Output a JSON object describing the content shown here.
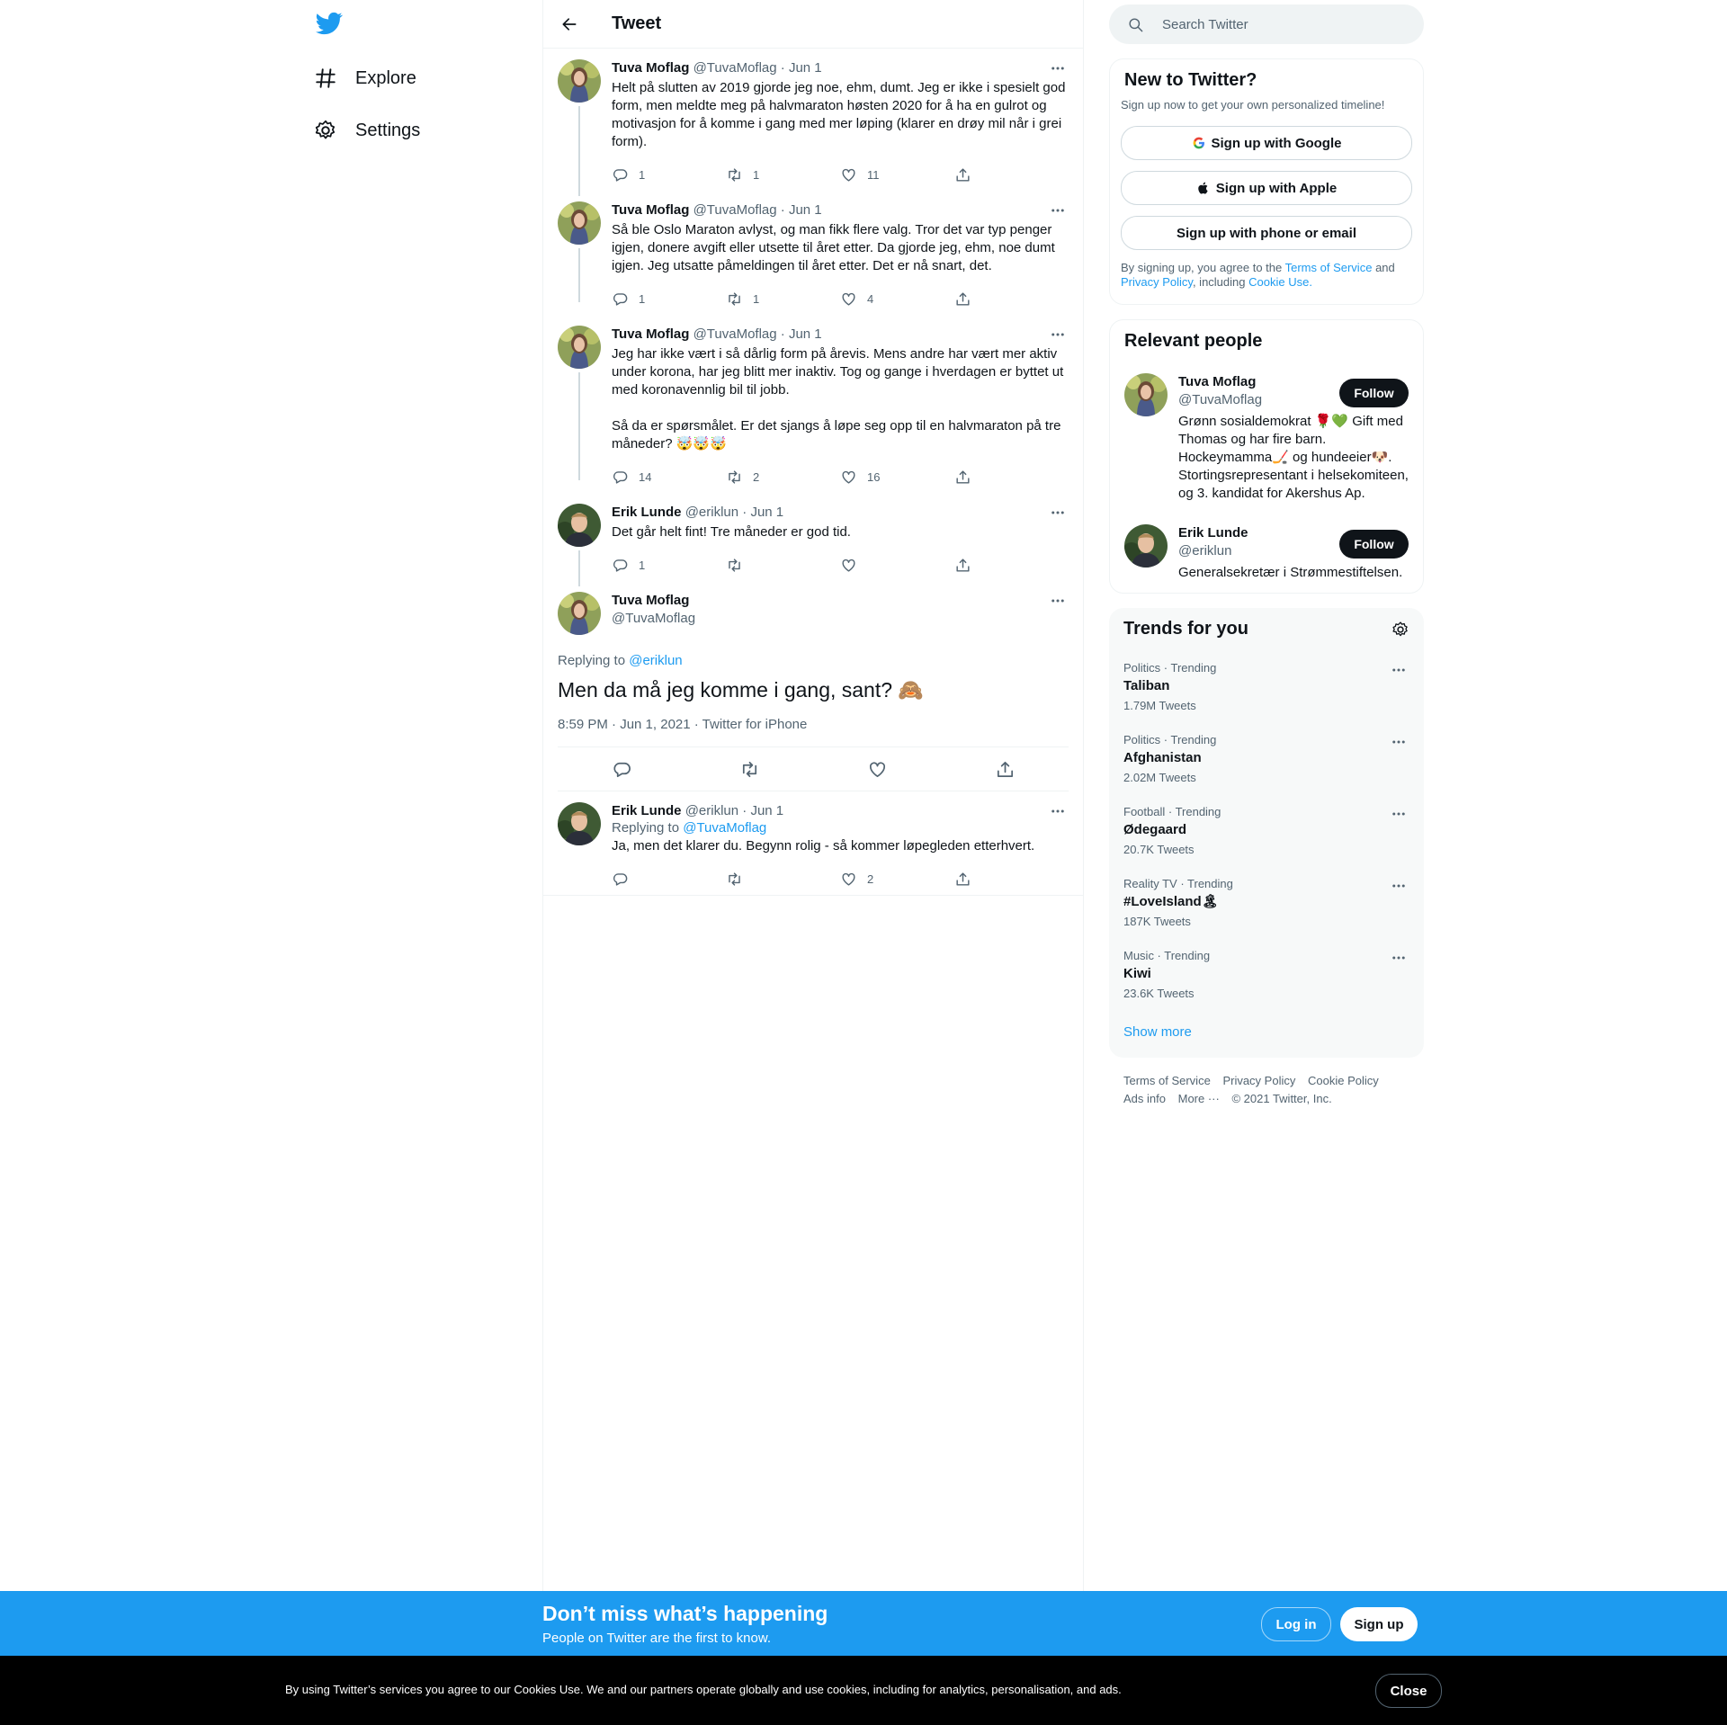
{
  "colors": {
    "accent": "#1d9bf0",
    "text": "#0f1419",
    "secondary": "#536471"
  },
  "nav": {
    "items": [
      {
        "label": "Explore",
        "icon": "hashtag-icon"
      },
      {
        "label": "Settings",
        "icon": "gear-icon"
      }
    ]
  },
  "header": {
    "title": "Tweet"
  },
  "thread": [
    {
      "name": "Tuva Moflag",
      "handle": "@TuvaMoflag",
      "date": "· Jun 1",
      "text": "Helt på slutten av 2019 gjorde jeg noe, ehm, dumt. Jeg er ikke i spesielt god form, men meldte meg på halvmaraton høsten 2020 for å ha en gulrot og motivasjon for å komme i gang med mer løping (klarer en drøy mil når i grei form).",
      "replies": "1",
      "retweets": "1",
      "likes": "11"
    },
    {
      "name": "Tuva Moflag",
      "handle": "@TuvaMoflag",
      "date": "· Jun 1",
      "text": "Så ble Oslo Maraton avlyst, og man fikk flere valg. Tror det var typ penger igjen, donere avgift eller utsette til året etter. Da gjorde jeg, ehm, noe dumt igjen. Jeg utsatte påmeldingen til året etter. Det er nå snart, det.",
      "replies": "1",
      "retweets": "1",
      "likes": "4"
    },
    {
      "name": "Tuva Moflag",
      "handle": "@TuvaMoflag",
      "date": "· Jun 1",
      "text": "Jeg har ikke vært i så dårlig form på årevis. Mens andre har vært mer aktiv under korona, har jeg blitt mer inaktiv. Tog og gange i hverdagen er byttet ut med koronavennlig bil til jobb.\n\nSå da er spørsmålet. Er det sjangs å løpe seg opp til en halvmaraton på tre måneder? 🤯🤯🤯",
      "replies": "14",
      "retweets": "2",
      "likes": "16"
    },
    {
      "name": "Erik Lunde",
      "handle": "@eriklun",
      "date": "· Jun 1",
      "text": "Det går helt fint! Tre måneder er god tid.",
      "replies": "1",
      "retweets": "",
      "likes": ""
    }
  ],
  "focus": {
    "name": "Tuva Moflag",
    "handle": "@TuvaMoflag",
    "replying_label": "Replying to",
    "replying_to": "@eriklun",
    "text": "Men da må jeg komme i gang, sant? 🙈",
    "meta": "8:59 PM · Jun 1, 2021 · Twitter for iPhone"
  },
  "reply": {
    "name": "Erik Lunde",
    "handle": "@eriklun",
    "date": "· Jun 1",
    "replying_label": "Replying to",
    "replying_to": "@TuvaMoflag",
    "text": "Ja, men det klarer du. Begynn rolig - så kommer løpegleden etterhvert.",
    "replies": "",
    "retweets": "",
    "likes": "2"
  },
  "search": {
    "placeholder": "Search Twitter"
  },
  "signup": {
    "title": "New to Twitter?",
    "subtitle": "Sign up now to get your own personalized timeline!",
    "google": "Sign up with Google",
    "apple": "Sign up with Apple",
    "phone": "Sign up with phone or email",
    "legal_1": "By signing up, you agree to the",
    "terms": "Terms of Service",
    "and": "and",
    "privacy": "Privacy Policy",
    "including": ", including",
    "cookie": "Cookie Use."
  },
  "relevant": {
    "title": "Relevant people",
    "people": [
      {
        "name": "Tuva Moflag",
        "handle": "@TuvaMoflag",
        "bio": "Grønn sosialdemokrat 🌹💚 Gift med Thomas og har fire barn. Hockeymamma🏒 og hundeeier🐶. Stortingsrepresentant i helsekomiteen, og 3. kandidat for Akershus Ap.",
        "follow": "Follow"
      },
      {
        "name": "Erik Lunde",
        "handle": "@eriklun",
        "bio": "Generalsekretær i Strømmestiftelsen.",
        "follow": "Follow"
      }
    ]
  },
  "trends": {
    "title": "Trends for you",
    "items": [
      {
        "meta": "Politics · Trending",
        "name": "Taliban",
        "count": "1.79M Tweets"
      },
      {
        "meta": "Politics · Trending",
        "name": "Afghanistan",
        "count": "2.02M Tweets"
      },
      {
        "meta": "Football · Trending",
        "name": "Ødegaard",
        "count": "20.7K Tweets"
      },
      {
        "meta": "Reality TV · Trending",
        "name": "#LoveIsland🏝",
        "count": "187K Tweets"
      },
      {
        "meta": "Music · Trending",
        "name": "Kiwi",
        "count": "23.6K Tweets"
      }
    ],
    "show_more": "Show more"
  },
  "footer": {
    "terms": "Terms of Service",
    "privacy": "Privacy Policy",
    "cookie": "Cookie Policy",
    "ads": "Ads info",
    "more": "More ···",
    "copyright": "© 2021 Twitter, Inc."
  },
  "banner": {
    "title": "Don’t miss what’s happening",
    "subtitle": "People on Twitter are the first to know.",
    "login": "Log in",
    "signup": "Sign up"
  },
  "cookie": {
    "text": "By using Twitter’s services you agree to our Cookies Use. We and our partners operate globally and use cookies, including for analytics, personalisation, and ads.",
    "close": "Close"
  }
}
